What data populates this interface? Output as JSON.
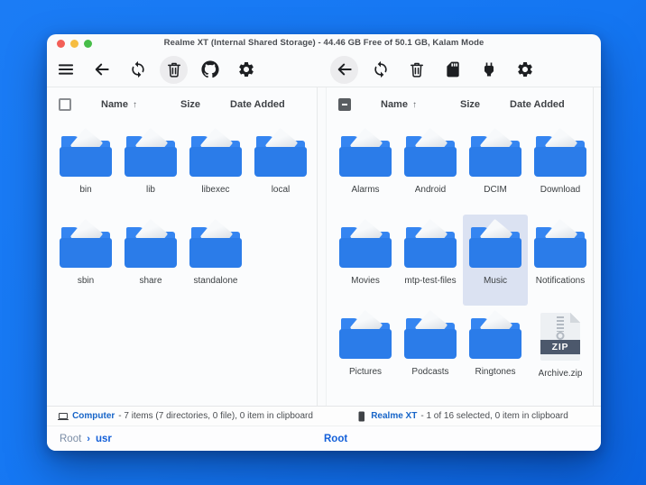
{
  "window": {
    "title": "Realme XT (Internal Shared Storage) - 44.46 GB Free of 50.1 GB, Kalam Mode"
  },
  "columns": {
    "name": "Name",
    "sort_arrow": "↑",
    "size": "Size",
    "date_added": "Date Added"
  },
  "zip_badge": "ZIP",
  "left_pane": {
    "items": [
      {
        "name": "bin",
        "type": "folder"
      },
      {
        "name": "lib",
        "type": "folder"
      },
      {
        "name": "libexec",
        "type": "folder"
      },
      {
        "name": "local",
        "type": "folder"
      },
      {
        "name": "sbin",
        "type": "folder"
      },
      {
        "name": "share",
        "type": "folder"
      },
      {
        "name": "standalone",
        "type": "folder"
      }
    ],
    "status_device": "Computer",
    "status_text": "- 7 items (7 directories, 0 file), 0 item in clipboard",
    "breadcrumb": {
      "root": "Root",
      "separator": "›",
      "current": "usr"
    }
  },
  "right_pane": {
    "items": [
      {
        "name": "Alarms",
        "type": "folder"
      },
      {
        "name": "Android",
        "type": "folder"
      },
      {
        "name": "DCIM",
        "type": "folder"
      },
      {
        "name": "Download",
        "type": "folder"
      },
      {
        "name": "Movies",
        "type": "folder"
      },
      {
        "name": "mtp-test-files",
        "type": "folder"
      },
      {
        "name": "Music",
        "type": "folder",
        "selected": true
      },
      {
        "name": "Notifications",
        "type": "folder"
      },
      {
        "name": "Pictures",
        "type": "folder"
      },
      {
        "name": "Podcasts",
        "type": "folder"
      },
      {
        "name": "Ringtones",
        "type": "folder"
      },
      {
        "name": "Archive.zip",
        "type": "zip"
      }
    ],
    "status_device": "Realme XT",
    "status_text": "- 1 of 16 selected, 0 item in clipboard",
    "breadcrumb": {
      "root": "Root"
    }
  },
  "colors": {
    "background_blue": "#1476f2",
    "folder_front": "#2b7ce9",
    "folder_back": "#3585f1",
    "selection": "#dbe2f2",
    "link_blue": "#1765c8",
    "breadcrumb_blue": "#1460d9",
    "zip_band": "#4c586c"
  }
}
